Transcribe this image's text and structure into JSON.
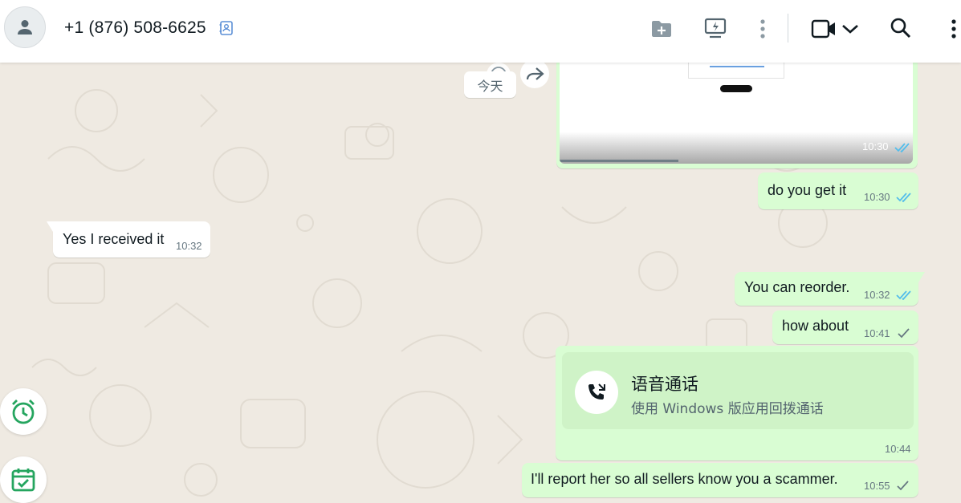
{
  "header": {
    "contact_name": "+1 (876) 508-6625",
    "icons": [
      "avatar-person-icon",
      "contact-card-icon",
      "add-folder-icon",
      "screen-share-icon",
      "more-vertical-icon",
      "video-call-icon",
      "chevron-down-icon",
      "search-icon",
      "menu-vertical-icon"
    ]
  },
  "chat": {
    "date_chip": "今天",
    "messages": [
      {
        "direction": "out",
        "type": "image",
        "time": "10:30",
        "status": "read"
      },
      {
        "direction": "out",
        "text": "do you get it",
        "time": "10:30",
        "status": "read"
      },
      {
        "direction": "in",
        "text": "Yes I received it",
        "time": "10:32"
      },
      {
        "direction": "out",
        "text": "You can reorder.",
        "time": "10:32",
        "status": "read"
      },
      {
        "direction": "out",
        "text": "how about",
        "time": "10:41",
        "status": "sent"
      },
      {
        "direction": "out",
        "type": "call",
        "call_title": "语音通话",
        "call_subtitle": "使用 Windows 版应用回拨通话",
        "time": "10:44"
      },
      {
        "direction": "out",
        "text": "I'll report her so all sellers know you a scammer.",
        "time": "10:55",
        "status": "sent"
      }
    ]
  },
  "colors": {
    "outgoing_bubble": "#d9fdd3",
    "incoming_bubble": "#ffffff",
    "read_tick": "#53bdeb",
    "accent_green": "#25d366",
    "chat_bg": "#efeae2"
  },
  "side_buttons": [
    "alarm-clock-icon",
    "calendar-check-icon"
  ]
}
